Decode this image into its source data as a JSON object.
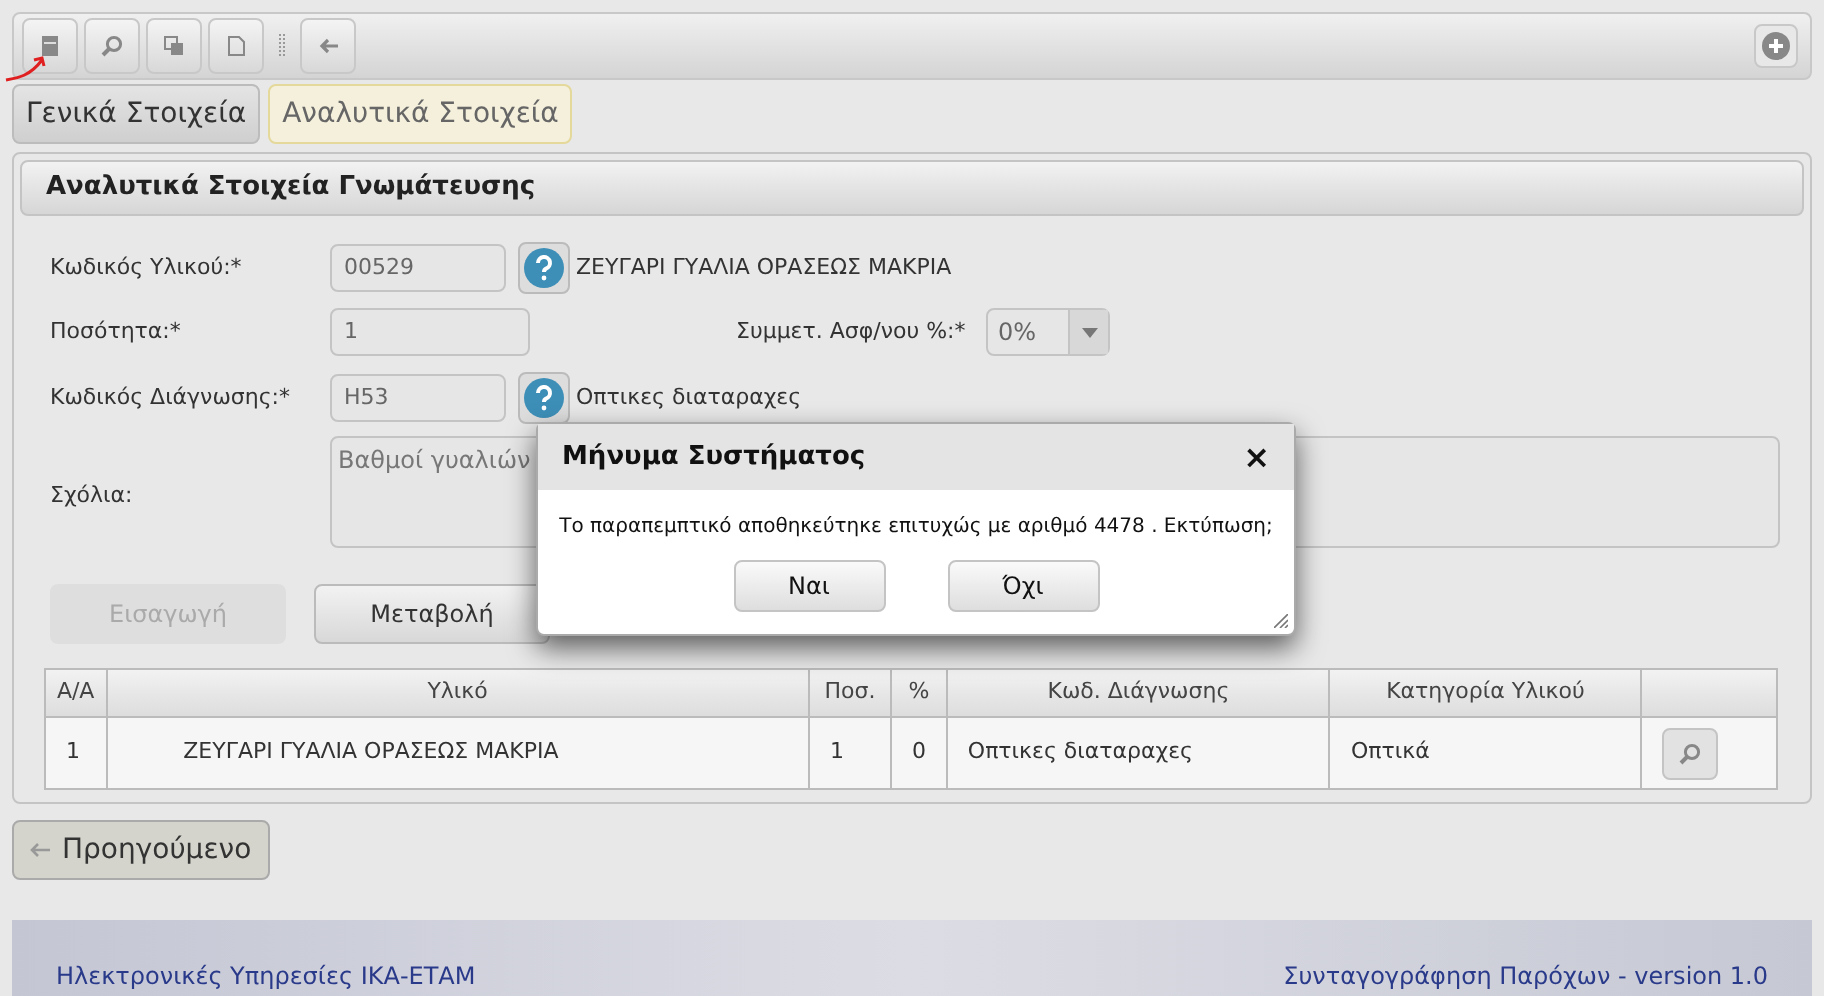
{
  "tabs": [
    {
      "label": "Γενικά Στοιχεία",
      "selected": false
    },
    {
      "label": "Αναλυτικά Στοιχεία",
      "selected": true
    }
  ],
  "panel": {
    "title": "Αναλυτικά Στοιχεία Γνωμάτευσης",
    "material_code": {
      "label": "Κωδικός Υλικού:*",
      "value": "00529",
      "description": "ΖΕΥΓΑΡΙ ΓΥΑΛΙΑ ΟΡΑΣΕΩΣ ΜΑΚΡΙΑ"
    },
    "quantity": {
      "label": "Ποσότητα:*",
      "value": "1"
    },
    "co_payment": {
      "label": "Συμμετ. Ασφ/νου %:*",
      "value": "0%"
    },
    "diagnosis_code": {
      "label": "Κωδικός Διάγνωσης:*",
      "value": "H53",
      "description": "Οπτικες διαταραχες"
    },
    "comments": {
      "label": "Σχόλια:",
      "value": "Βαθμοί γυαλιών"
    },
    "buttons": [
      {
        "label": "Εισαγωγή",
        "disabled": true
      },
      {
        "label": "Μεταβολή",
        "disabled": false
      }
    ],
    "table": {
      "columns": [
        "Α/Α",
        "Υλικό",
        "Ποσ.",
        "%",
        "Κωδ. Διάγνωσης",
        "Κατηγορία Υλικού"
      ],
      "rows": [
        [
          "1",
          "ΖΕΥΓΑΡΙ ΓΥΑΛΙΑ ΟΡΑΣΕΩΣ ΜΑΚΡΙΑ",
          "1",
          "0",
          "Οπτικες διαταραχες",
          "Οπτικά"
        ]
      ]
    }
  },
  "previous_button": "Προηγούμενο",
  "footer": {
    "left": "Ηλεκτρονικές Υπηρεσίες ΙΚΑ-ΕΤΑΜ",
    "right": "Συνταγογράφηση Παρόχων - version 1.0"
  },
  "dialog": {
    "title": "Μήνυμα Συστήματος",
    "close": "×",
    "message": "Το παραπεμπτικό αποθηκεύτηκε επιτυχώς με αριθμό 4478 . Εκτύπωση;",
    "buttons": [
      "Ναι",
      "Όχι"
    ]
  }
}
